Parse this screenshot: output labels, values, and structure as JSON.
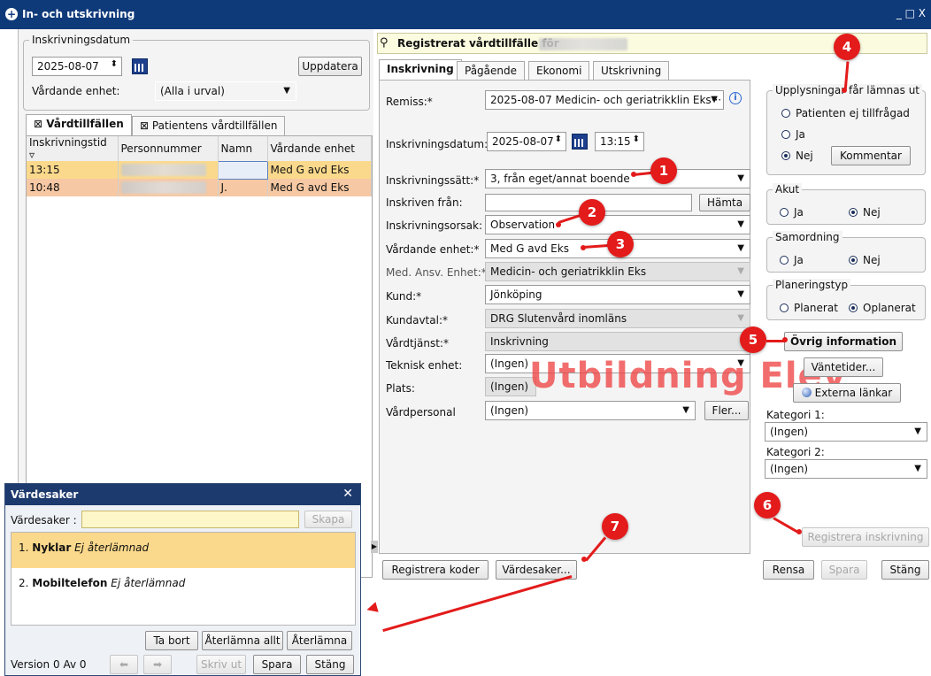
{
  "window": {
    "title": "In- och utskrivning",
    "controls": "_ □ X"
  },
  "left": {
    "group_label": "Inskrivningsdatum",
    "date_value": "2025-08-07",
    "update_button": "Uppdatera",
    "unit_label": "Vårdande enhet:",
    "unit_value": "(Alla i urval)",
    "tabs": [
      "Vårdtillfällen",
      "Patientens vårdtillfällen"
    ],
    "columns": [
      "Inskrivningstid",
      "Personnummer",
      "Namn",
      "Vårdande enhet"
    ],
    "rows": [
      {
        "time": "13:15",
        "name_suffix": "",
        "unit": "Med G avd Eks"
      },
      {
        "time": "10:48",
        "name_suffix": "J.",
        "unit": "Med G avd Eks"
      }
    ]
  },
  "right": {
    "header_title": "Registrerat vårdtillfälle för",
    "tabs": [
      "Inskrivning",
      "Pågående",
      "Ekonomi",
      "Utskrivning"
    ],
    "fields": {
      "remiss_label": "Remiss:*",
      "remiss_value": "2025-08-07 Medicin- och geriatrikklin Eks···",
      "date_label": "Inskrivningsdatum:*",
      "date_value": "2025-08-07",
      "time_value": "13:15",
      "method_label": "Inskrivningssätt:*",
      "method_value": "3, från eget/annat boende",
      "from_label": "Inskriven från:",
      "fetch_button": "Hämta",
      "reason_label": "Inskrivningsorsak:",
      "reason_value": "Observation",
      "unit_label": "Vårdande enhet:*",
      "unit_value": "Med G avd Eks",
      "med_label": "Med. Ansv. Enhet:*",
      "med_value": "Medicin- och geriatrikklin Eks",
      "customer_label": "Kund:*",
      "customer_value": "Jönköping",
      "contract_label": "Kundavtal:*",
      "contract_value": "DRG Slutenvård inomläns",
      "service_label": "Vårdtjänst:*",
      "service_value": "Inskrivning",
      "tech_label": "Teknisk enhet:",
      "tech_value": "(Ingen)",
      "place_label": "Plats:",
      "place_value": "(Ingen)",
      "staff_label": "Vårdpersonal",
      "staff_value": "(Ingen)",
      "more_button": "Fler..."
    },
    "info_group": {
      "label": "Upplysningar får lämnas ut",
      "opt1": "Patienten ej tillfrågad",
      "opt2": "Ja",
      "opt3": "Nej",
      "comment_button": "Kommentar"
    },
    "akut": {
      "label": "Akut",
      "yes": "Ja",
      "no": "Nej"
    },
    "samordning": {
      "label": "Samordning",
      "yes": "Ja",
      "no": "Nej"
    },
    "planering": {
      "label": "Planeringstyp",
      "opt1": "Planerat",
      "opt2": "Oplanerat"
    },
    "buttons": {
      "other_info": "Övrig information",
      "wait_times": "Väntetider...",
      "external_links": "Externa länkar",
      "register": "Registrera inskrivning",
      "register_codes": "Registrera koder",
      "valuables": "Värdesaker...",
      "clear": "Rensa",
      "save": "Spara",
      "close": "Stäng"
    },
    "category1_label": "Kategori 1:",
    "category1_value": "(Ingen)",
    "category2_label": "Kategori 2:",
    "category2_value": "(Ingen)",
    "watermark": "Utbildning Elev"
  },
  "dialog": {
    "title": "Värdesaker",
    "field_label": "Värdesaker :",
    "create_button": "Skapa",
    "items": [
      {
        "num": "1.",
        "name": "Nyklar",
        "status": "Ej återlämnad"
      },
      {
        "num": "2.",
        "name": "Mobiltelefon",
        "status": "Ej återlämnad"
      }
    ],
    "remove_button": "Ta bort",
    "return_all_button": "Återlämna allt",
    "return_button": "Återlämna",
    "version_label": "Version",
    "version_value": "0",
    "of_label": "Av",
    "of_value": "0",
    "print_button": "Skriv ut",
    "save_button": "Spara",
    "close_button": "Stäng"
  },
  "annotations": [
    "1",
    "2",
    "3",
    "4",
    "5",
    "6",
    "7"
  ]
}
